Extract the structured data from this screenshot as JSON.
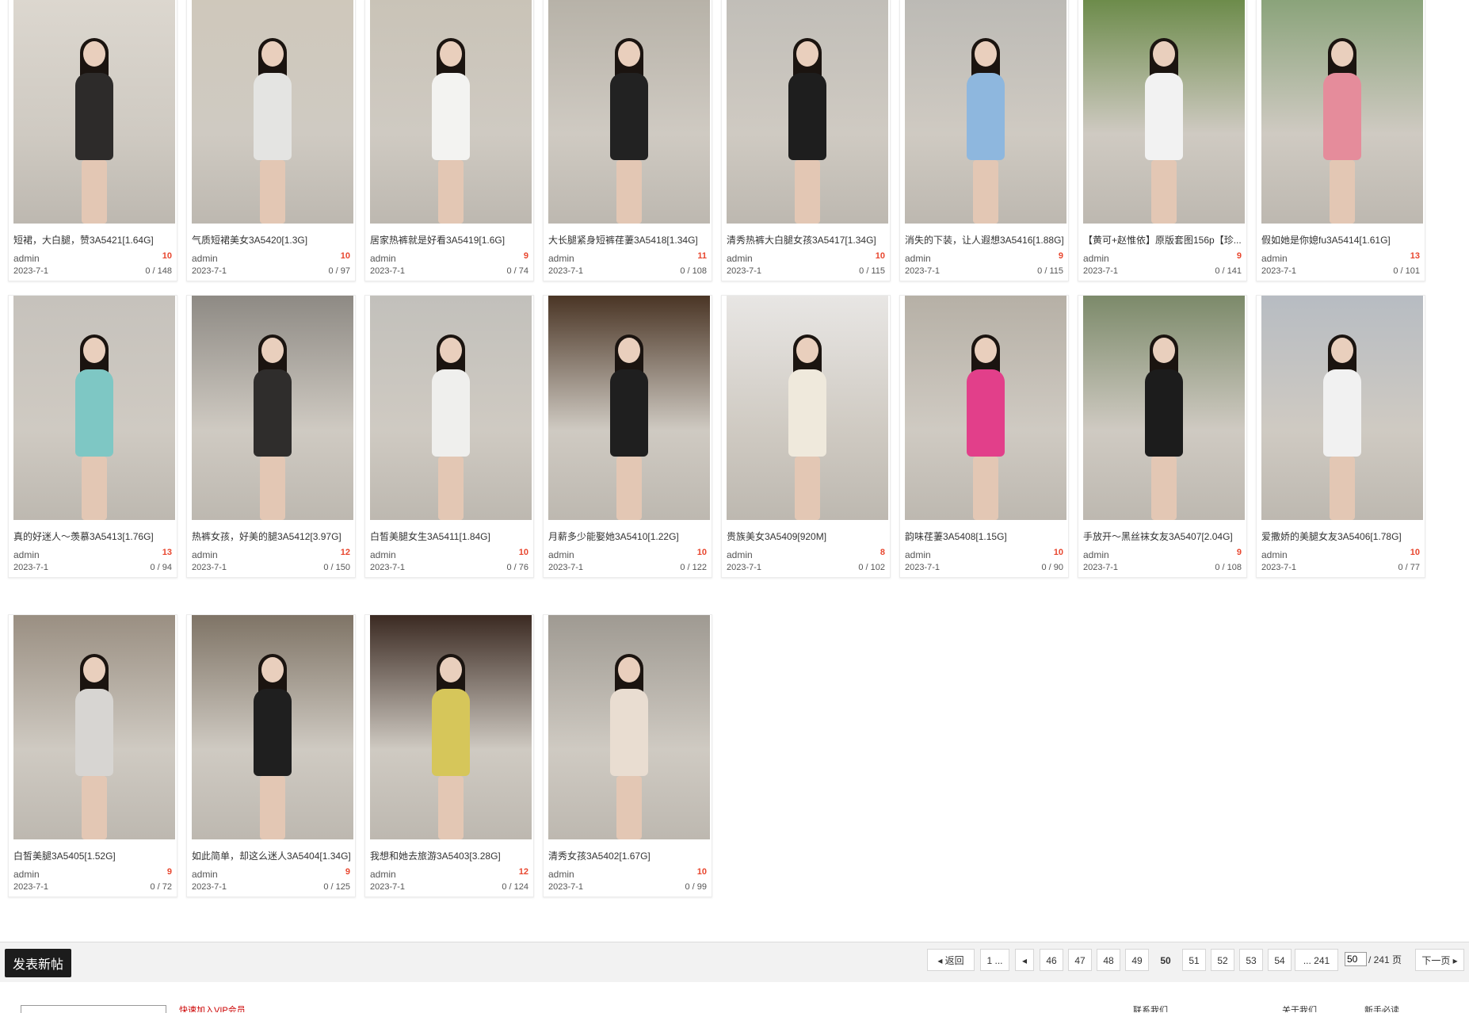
{
  "posts": [
    {
      "title": "短裙，大白腿，赞3A5421[1.64G]",
      "author": "admin",
      "count": "10",
      "date": "2023-7-1",
      "stats": "0 / 148",
      "colors": [
        "#2d2b2a",
        "#1a1a1a",
        "#dcd7cf"
      ]
    },
    {
      "title": "气质短裙美女3A5420[1.3G]",
      "author": "admin",
      "count": "10",
      "date": "2023-7-1",
      "stats": "0 / 97",
      "colors": [
        "#e4e4e2",
        "#f1f1ef",
        "#cfc8bb"
      ]
    },
    {
      "title": "居家热裤就是好看3A5419[1.6G]",
      "author": "admin",
      "count": "9",
      "date": "2023-7-1",
      "stats": "0 / 74",
      "colors": [
        "#f3f3f1",
        "#222222",
        "#c9c3b7"
      ]
    },
    {
      "title": "大长腿紧身短裤荏萋3A5418[1.34G]",
      "author": "admin",
      "count": "11",
      "date": "2023-7-1",
      "stats": "0 / 108",
      "colors": [
        "#222222",
        "#2e3a55",
        "#b7b2a8"
      ]
    },
    {
      "title": "清秀热裤大白腿女孩3A5417[1.34G]",
      "author": "admin",
      "count": "10",
      "date": "2023-7-1",
      "stats": "0 / 115",
      "colors": [
        "#1e1e1e",
        "#6e6b69",
        "#c1beb8"
      ]
    },
    {
      "title": "消失的下装，让人遐想3A5416[1.88G]",
      "author": "admin",
      "count": "9",
      "date": "2023-7-1",
      "stats": "0 / 115",
      "colors": [
        "#8eb7de",
        "#a9c8e5",
        "#bcbab5"
      ]
    },
    {
      "title": "【黄可+赵惟依】原版套图156p【珍...",
      "author": "admin",
      "count": "9",
      "date": "2023-7-1",
      "stats": "0 / 141",
      "colors": [
        "#f2f2f2",
        "#d9262f",
        "#6c8b4a"
      ]
    },
    {
      "title": "假如她是你媳fu3A5414[1.61G]",
      "author": "admin",
      "count": "13",
      "date": "2023-7-1",
      "stats": "0 / 101",
      "colors": [
        "#e58c9b",
        "#de7e8e",
        "#8aa37a"
      ]
    },
    {
      "title": "真的好迷人～羡慕3A5413[1.76G]",
      "author": "admin",
      "count": "13",
      "date": "2023-7-1",
      "stats": "0 / 94",
      "colors": [
        "#7ec7c4",
        "#89cfcc",
        "#c6c2bc"
      ]
    },
    {
      "title": "热裤女孩，好美的腿3A5412[3.97G]",
      "author": "admin",
      "count": "12",
      "date": "2023-7-1",
      "stats": "0 / 150",
      "colors": [
        "#2f2d2c",
        "#a9b6c3",
        "#8e8a84"
      ]
    },
    {
      "title": "白皙美腿女生3A5411[1.84G]",
      "author": "admin",
      "count": "10",
      "date": "2023-7-1",
      "stats": "0 / 76",
      "colors": [
        "#efefed",
        "#f7f6f3",
        "#c2c0bb"
      ]
    },
    {
      "title": "月薪多少能娶她3A5410[1.22G]",
      "author": "admin",
      "count": "10",
      "date": "2023-7-1",
      "stats": "0 / 122",
      "colors": [
        "#1f1f1f",
        "#2a2a2a",
        "#4a3525"
      ]
    },
    {
      "title": "贵族美女3A5409[920M]",
      "author": "admin",
      "count": "8",
      "date": "2023-7-1",
      "stats": "0 / 102",
      "colors": [
        "#efe9dc",
        "#d8c79d",
        "#e8e6e4"
      ]
    },
    {
      "title": "韵味荏萋3A5408[1.15G]",
      "author": "admin",
      "count": "10",
      "date": "2023-7-1",
      "stats": "0 / 90",
      "colors": [
        "#e23f8a",
        "#e8559a",
        "#b6b0a6"
      ]
    },
    {
      "title": "手放开～黑丝袜女友3A5407[2.04G]",
      "author": "admin",
      "count": "9",
      "date": "2023-7-1",
      "stats": "0 / 108",
      "colors": [
        "#1c1c1c",
        "#2a2a2a",
        "#7c8a6a"
      ]
    },
    {
      "title": "爱撒娇的美腿女友3A5406[1.78G]",
      "author": "admin",
      "count": "10",
      "date": "2023-7-1",
      "stats": "0 / 77",
      "colors": [
        "#f1f1f1",
        "#8d8a86",
        "#b7bcc2"
      ]
    },
    {
      "title": "白皙美腿3A5405[1.52G]",
      "author": "admin",
      "count": "9",
      "date": "2023-7-1",
      "stats": "0 / 72",
      "colors": [
        "#d7d5d2",
        "#1c1c1c",
        "#9a8f82"
      ]
    },
    {
      "title": "如此简单，却这么迷人3A5404[1.34G]",
      "author": "admin",
      "count": "9",
      "date": "2023-7-1",
      "stats": "0 / 125",
      "colors": [
        "#1f1f1f",
        "#9fb3c9",
        "#7f7466"
      ]
    },
    {
      "title": "我想和她去旅游3A5403[3.28G]",
      "author": "admin",
      "count": "12",
      "date": "2023-7-1",
      "stats": "0 / 124",
      "colors": [
        "#d6c65a",
        "#cdbd50",
        "#3b2a22"
      ]
    },
    {
      "title": "清秀女孩3A5402[1.67G]",
      "author": "admin",
      "count": "10",
      "date": "2023-7-1",
      "stats": "0 / 99",
      "colors": [
        "#e9ddd1",
        "#e2d3c4",
        "#9f9a92"
      ]
    }
  ],
  "footer": {
    "new_post": "发表新帖",
    "back": "返回",
    "first": "1 ...",
    "pages": [
      "46",
      "47",
      "48",
      "49",
      "50",
      "51",
      "52",
      "53",
      "54"
    ],
    "current": "50",
    "last": "... 241",
    "page_input": "50",
    "page_total": "/ 241 页",
    "next": "下一页"
  },
  "bottom": {
    "notice": "快速加入VIP会员",
    "link1": "联系我们",
    "link2": "关于我们",
    "link3": "新手必读"
  },
  "colors": {
    "accent_red": "#e8462e",
    "new_post_bg": "#1c1c1c"
  }
}
